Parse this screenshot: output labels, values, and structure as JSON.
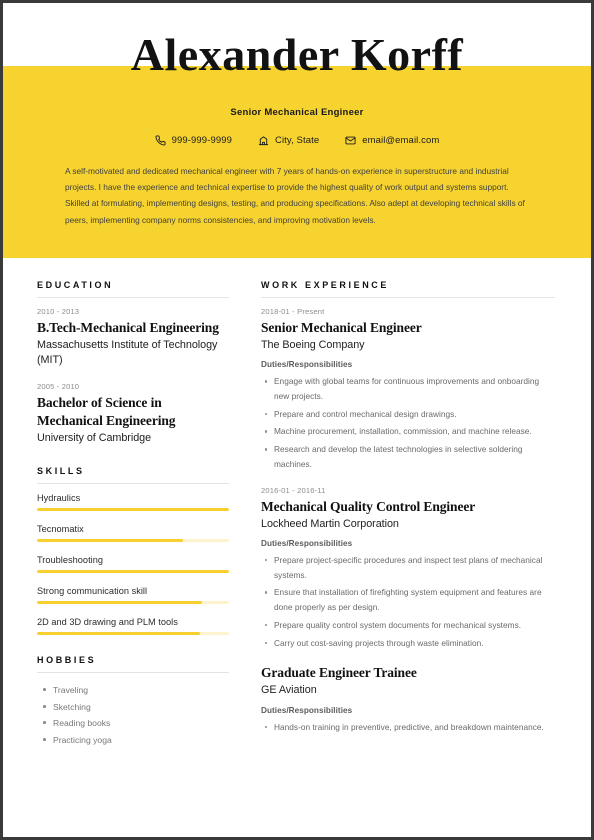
{
  "theme": {
    "accent": "#f7d330",
    "accent_bar": "#f7cf2e",
    "accent_bar_track": "#fdf4cf",
    "text_dark": "#111111",
    "text_muted": "#6a6a6a",
    "divider": "#e3e3e3"
  },
  "header": {
    "name": "Alexander Korff",
    "job_title": "Senior Mechanical Engineer",
    "contacts": [
      {
        "icon": "phone-icon",
        "value": "999-999-9999"
      },
      {
        "icon": "location-icon",
        "value": "City, State"
      },
      {
        "icon": "email-icon",
        "value": "email@email.com"
      }
    ],
    "summary": "A self-motivated and dedicated mechanical engineer with 7 years of hands-on experience in superstructure and industrial projects. I have the experience and technical expertise to provide the highest quality of work output and systems support. Skilled at formulating, implementing designs, testing, and producing specifications. Also adept at developing technical skills of peers, implementing company norms consistencies, and improving motivation levels."
  },
  "education": {
    "title": "EDUCATION",
    "entries": [
      {
        "date": "2010 - 2013",
        "degree": "B.Tech-Mechanical Engineering",
        "school": "Massachusetts Institute of Technology (MIT)"
      },
      {
        "date": "2005 - 2010",
        "degree": "Bachelor of Science in Mechanical Engineering",
        "school": "University of Cambridge"
      }
    ]
  },
  "skills": {
    "title": "SKILLS",
    "items": [
      {
        "name": "Hydraulics",
        "level": 100
      },
      {
        "name": "Tecnomatix",
        "level": 76
      },
      {
        "name": "Troubleshooting",
        "level": 100
      },
      {
        "name": "Strong communication skill",
        "level": 86
      },
      {
        "name": "2D and 3D drawing and PLM tools",
        "level": 85
      }
    ]
  },
  "hobbies": {
    "title": "HOBBIES",
    "items": [
      "Traveling",
      "Sketching",
      "Reading books",
      "Practicing yoga"
    ]
  },
  "work": {
    "title": "WORK EXPERIENCE",
    "entries": [
      {
        "date": "2018-01 - Present",
        "role": "Senior Mechanical Engineer",
        "company": "The Boeing Company",
        "subhead": "Duties/Responsibilities",
        "duties": [
          "Engage with global teams for continuous improvements and onboarding new projects.",
          "Prepare and control mechanical design drawings.",
          "Machine procurement, installation, commission, and machine release.",
          "Research and develop the latest technologies in selective soldering machines."
        ]
      },
      {
        "date": "2016-01 - 2016-11",
        "role": "Mechanical Quality Control Engineer",
        "company": "Lockheed Martin Corporation",
        "subhead": "Duties/Responsibilities",
        "duties": [
          "Prepare project-specific procedures and inspect test plans of mechanical systems.",
          "Ensure that installation of firefighting system equipment and features are done properly as per design.",
          "Prepare quality control system documents for mechanical systems.",
          "Carry out cost-saving projects through waste elimination."
        ]
      },
      {
        "date": "",
        "role": "Graduate Engineer Trainee",
        "company": "GE Aviation",
        "subhead": "Duties/Responsibilities",
        "duties": [
          "Hands-on training in preventive, predictive, and breakdown maintenance."
        ]
      }
    ]
  }
}
